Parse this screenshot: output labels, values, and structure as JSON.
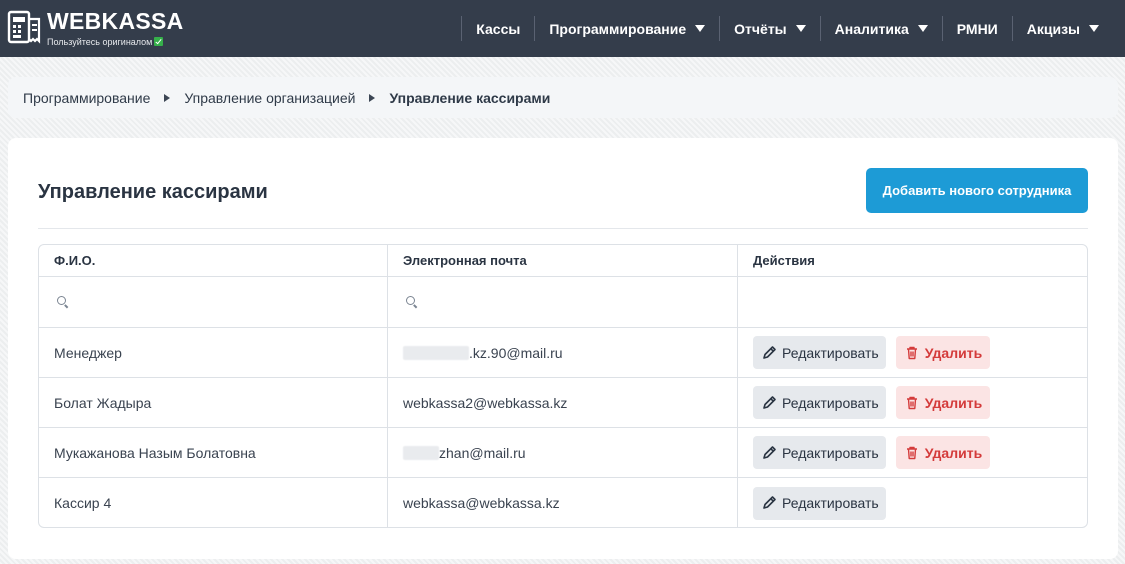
{
  "header": {
    "brand": "WEBKASSA",
    "tagline": "Пользуйтесь оригиналом",
    "nav": [
      {
        "label": "Кассы",
        "has_dropdown": false
      },
      {
        "label": "Программирование",
        "has_dropdown": true
      },
      {
        "label": "Отчёты",
        "has_dropdown": true
      },
      {
        "label": "Аналитика",
        "has_dropdown": true
      },
      {
        "label": "РМНИ",
        "has_dropdown": false
      },
      {
        "label": "Акцизы",
        "has_dropdown": true
      }
    ]
  },
  "breadcrumb": [
    "Программирование",
    "Управление организацией",
    "Управление кассирами"
  ],
  "page": {
    "title": "Управление кассирами",
    "add_button": "Добавить нового сотрудника"
  },
  "table": {
    "columns": [
      "Ф.И.О.",
      "Электронная почта",
      "Действия"
    ],
    "rows": [
      {
        "name": "Менеджер",
        "email": ".kz.90@mail.ru",
        "email_redacted": true,
        "can_delete": true
      },
      {
        "name": "Болат Жадыра",
        "email": "webkassa2@webkassa.kz",
        "email_redacted": false,
        "can_delete": true
      },
      {
        "name": "Мукажанова Назым Болатовна",
        "email": "zhan@mail.ru",
        "email_redacted": true,
        "can_delete": true
      },
      {
        "name": "Кассир 4",
        "email": "webkassa@webkassa.kz",
        "email_redacted": false,
        "can_delete": false
      }
    ],
    "edit_label": "Редактировать",
    "delete_label": "Удалить"
  },
  "colors": {
    "header_bg": "#343d4b",
    "accent": "#1d9bd6",
    "danger": "#d43a3a",
    "danger_bg": "#fbe4e4"
  },
  "icons": {
    "logo": "register-doc-icon",
    "search": "search-icon",
    "edit": "pencil-icon",
    "delete": "trash-icon",
    "dropdown": "caret-down-icon",
    "breadcrumb_sep": "caret-right-icon"
  }
}
